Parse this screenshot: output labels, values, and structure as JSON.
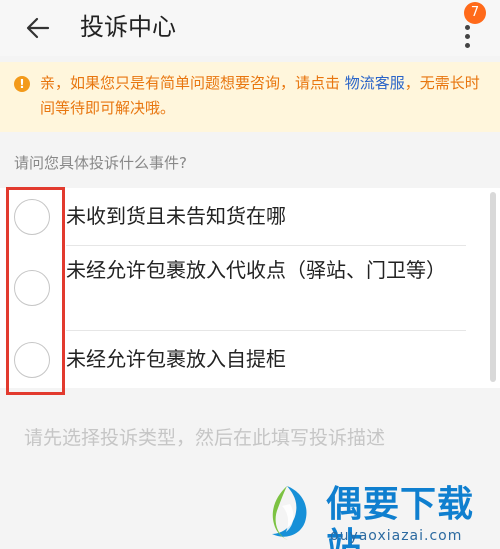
{
  "header": {
    "title": "投诉中心",
    "badge_count": "7"
  },
  "notice": {
    "prefix": "亲，如果您只是有简单问题想要咨询，请点击 ",
    "link": "物流客服",
    "suffix": "，无需长时间等待即可解决哦。"
  },
  "question": "请问您具体投诉什么事件?",
  "options": [
    {
      "label": "未收到货且未告知货在哪"
    },
    {
      "label": "未经允许包裹放入代收点（驿站、门卫等）"
    },
    {
      "label": "未经允许包裹放入自提柜"
    }
  ],
  "description_placeholder": "请先选择投诉类型，然后在此填写投诉描述",
  "watermark": {
    "name": "偶要下载站",
    "url": "ouyaoxiazai.com"
  },
  "colors": {
    "notice_bg": "#fff6dc",
    "notice_text": "#e8760f",
    "link": "#2a64c8",
    "badge": "#ff6a1a",
    "highlight": "#e23a2e"
  }
}
